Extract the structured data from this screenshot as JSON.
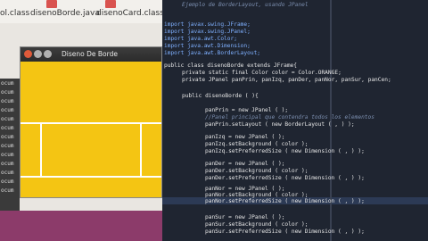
{
  "desktop": {
    "files": [
      "ol.class",
      "disenoBorde.java",
      "disenoCard.class"
    ],
    "sidebar_rows": [
      "ocum",
      "ocum",
      "ocum",
      "ocum",
      "ocum",
      "ocum",
      "ocum",
      "ocum",
      "ocum",
      "ocum",
      "ocum",
      "ocum",
      "ocum"
    ]
  },
  "window": {
    "title": "Diseno De Borde",
    "colors": {
      "panel": "#f4c513",
      "titlebar": "#2b2b2b",
      "close": "#e05a3a",
      "min": "#b0b0b0",
      "max": "#b0b0b0"
    }
  },
  "code": {
    "comment_top": "Ejemplo de BorderLayout, usando JPanel",
    "lines": [
      "import javax.swing.JFrame;",
      "import javax.swing.JPanel;",
      "import java.awt.Color;",
      "import java.awt.Dimension;",
      "import java.awt.BorderLayout;",
      "public class disenoBorde extends JFrame{",
      "private static final Color color = Color.ORANGE;",
      "private JPanel panPrin, panIzq, panDer, panNor, panSur, panCen;",
      "public disenoBorde ( ){",
      "panPrin = new JPanel ( );",
      "//Panel principal que contendra todos los elementos",
      "panPrin.setLayout ( new BorderLayout ( , ) );",
      "panIzq = new JPanel ( );",
      "panIzq.setBackground ( color );",
      "panIzq.setPreferredSize ( new Dimension ( , ) );",
      "panDer = new JPanel ( );",
      "panDer.setBackground ( color );",
      "panDer.setPreferredSize ( new Dimension ( , ) );",
      "panNor = new JPanel ( );",
      "panNor.setBackground ( color );",
      "panNor.setPreferredSize ( new Dimension ( , ) );",
      "panSur = new JPanel ( );",
      "panSur.setBackground ( color );",
      "panSur.setPreferredSize ( new Dimension ( , ) );"
    ]
  }
}
